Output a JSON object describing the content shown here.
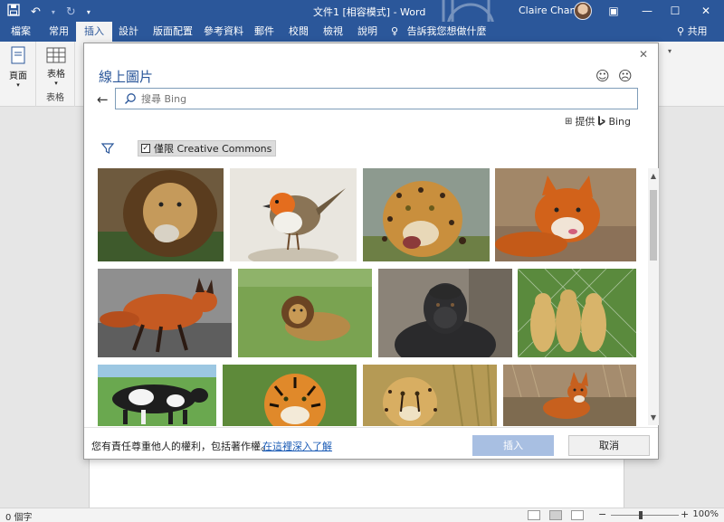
{
  "titlebar": {
    "document_title": "文件1 [相容模式] - Word",
    "user_name": "Claire Chang",
    "save_icon": "save-icon",
    "undo_icon": "undo-icon",
    "redo_icon": "redo-icon",
    "window_buttons": [
      "ribbon-display-options",
      "minimize",
      "maximize",
      "close"
    ]
  },
  "ribbon": {
    "tabs": [
      {
        "label": "檔案"
      },
      {
        "label": "常用"
      },
      {
        "label": "插入",
        "active": true
      },
      {
        "label": "設計"
      },
      {
        "label": "版面配置"
      },
      {
        "label": "參考資料"
      },
      {
        "label": "郵件"
      },
      {
        "label": "校閱"
      },
      {
        "label": "檢視"
      },
      {
        "label": "說明"
      }
    ],
    "tell_me": "告訴我您想做什麼",
    "share": "共用",
    "groups": {
      "pages_button": "頁面",
      "table_button": "表格",
      "table_group_label": "表格"
    }
  },
  "dialog": {
    "title": "線上圖片",
    "search_placeholder": "搜尋 Bing",
    "provider_label": "提供",
    "provider_name": "Bing",
    "creative_commons_label": "僅限 Creative Commons",
    "creative_commons_checked": true,
    "images": [
      {
        "subject": "lion"
      },
      {
        "subject": "robin"
      },
      {
        "subject": "leopard"
      },
      {
        "subject": "fox"
      },
      {
        "subject": "fox"
      },
      {
        "subject": "lion"
      },
      {
        "subject": "gorilla"
      },
      {
        "subject": "cheetahs"
      },
      {
        "subject": "cow"
      },
      {
        "subject": "tiger"
      },
      {
        "subject": "cheetah"
      },
      {
        "subject": "fox"
      }
    ],
    "legal_text": "您有責任尊重他人的權利，包括著作權。",
    "learn_more": "在這裡深入了解",
    "insert_button": "插入",
    "cancel_button": "取消"
  },
  "statusbar": {
    "word_count": "0 個字",
    "zoom": "100%"
  },
  "colors": {
    "brand": "#2b579a",
    "insert_disabled": "#a8bfe2",
    "link": "#1a5bb5"
  }
}
